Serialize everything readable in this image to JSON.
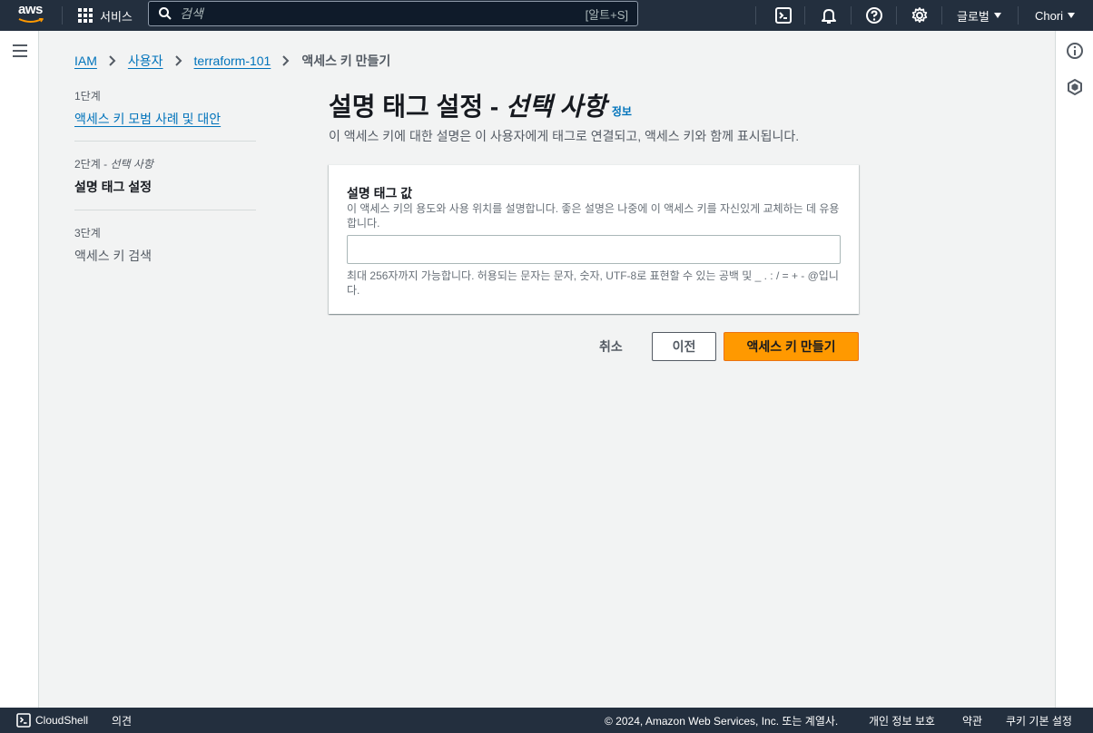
{
  "topnav": {
    "logo": "aws",
    "services_label": "서비스",
    "search_placeholder": "검색",
    "search_shortcut": "[알트+S]",
    "region_label": "글로벌",
    "user_label": "Chori",
    "icons": [
      "cloudshell-icon",
      "notifications-icon",
      "help-icon",
      "settings-icon"
    ]
  },
  "breadcrumb": {
    "items": [
      "IAM",
      "사용자",
      "terraform-101"
    ],
    "current": "액세스 키 만들기"
  },
  "steps": [
    {
      "number": "1단계",
      "label": "액세스 키 모범 사례 및 대안"
    },
    {
      "number": "2단계",
      "optional": "선택 사항",
      "label": "설명 태그 설정"
    },
    {
      "number": "3단계",
      "label": "액세스 키 검색"
    }
  ],
  "main": {
    "title": "설명 태그 설정 - ",
    "title_optional": "선택 사항",
    "info_link": "정보",
    "subtitle": "이 액세스 키에 대한 설명은 이 사용자에게 태그로 연결되고, 액세스 키와 함께 표시됩니다."
  },
  "form": {
    "label": "설명 태그 값",
    "description": "이 액세스 키의 용도와 사용 위치를 설명합니다. 좋은 설명은 나중에 이 액세스 키를 자신있게 교체하는 데 유용합니다.",
    "value": "",
    "constraint": "최대 256자까지 가능합니다. 허용되는 문자는 문자, 숫자, UTF-8로 표현할 수 있는 공백 및 _ . : / = + - @입니다."
  },
  "actions": {
    "cancel": "취소",
    "previous": "이전",
    "create": "액세스 키 만들기"
  },
  "footer": {
    "cloudshell": "CloudShell",
    "feedback": "의견",
    "copyright": "© 2024, Amazon Web Services, Inc. 또는 계열사.",
    "privacy": "개인 정보 보호",
    "terms": "약관",
    "cookies": "쿠키 기본 설정"
  },
  "colors": {
    "nav_bg": "#232f3e",
    "link": "#0073bb",
    "primary_button": "#ff9900",
    "page_bg": "#f2f3f3"
  }
}
